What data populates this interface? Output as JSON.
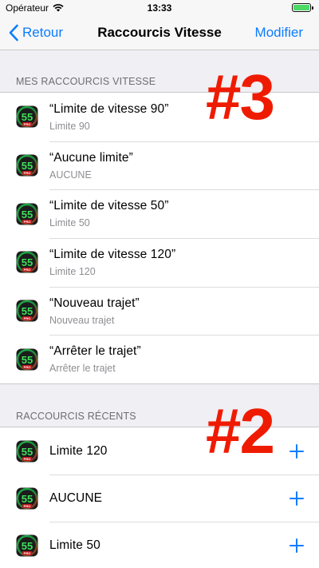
{
  "status": {
    "carrier": "Opérateur",
    "time": "13:33"
  },
  "nav": {
    "back_label": "Retour",
    "title": "Raccourcis Vitesse",
    "edit_label": "Modifier"
  },
  "sections": {
    "mine": {
      "header": "MES RACCOURCIS VITESSE",
      "items": [
        {
          "title": "“Limite de vitesse 90”",
          "subtitle": "Limite 90"
        },
        {
          "title": "“Aucune limite”",
          "subtitle": "AUCUNE"
        },
        {
          "title": "“Limite de vitesse 50”",
          "subtitle": "Limite 50"
        },
        {
          "title": "“Limite de vitesse 120”",
          "subtitle": "Limite 120"
        },
        {
          "title": "“Nouveau trajet”",
          "subtitle": "Nouveau trajet"
        },
        {
          "title": "“Arrêter le trajet”",
          "subtitle": "Arrêter le trajet"
        }
      ]
    },
    "recent": {
      "header": "RACCOURCIS RÉCENTS",
      "items": [
        {
          "title": "Limite 120"
        },
        {
          "title": "AUCUNE"
        },
        {
          "title": "Limite 50"
        }
      ]
    }
  },
  "app_icon": {
    "number": "55",
    "badge": "PRO",
    "icon": "speedometer-app-icon"
  },
  "overlays": {
    "top": "#3",
    "bottom": "#2"
  },
  "colors": {
    "accent": "#0b7cff",
    "overlay": "#ef1b00",
    "battery": "#4cd964"
  }
}
